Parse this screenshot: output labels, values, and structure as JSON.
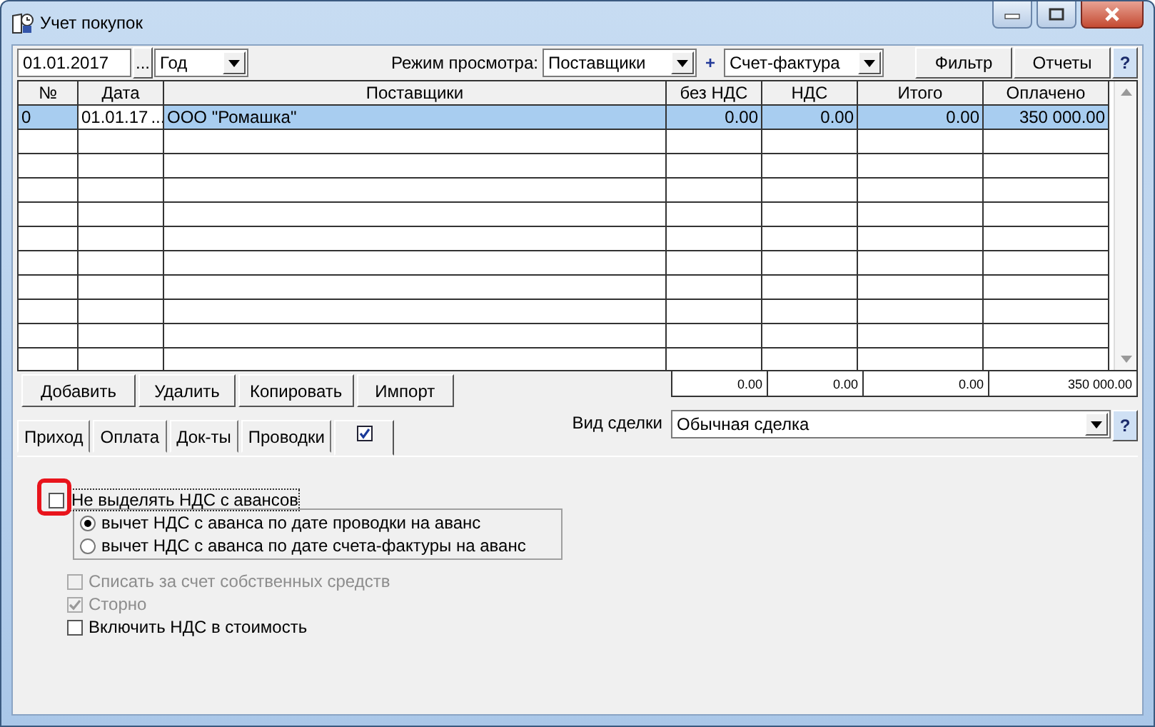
{
  "window": {
    "title": "Учет покупок"
  },
  "toolbar": {
    "date": "01.01.2017",
    "date_button": "...",
    "period": "Год",
    "view_mode_label": "Режим просмотра:",
    "view_mode": "Поставщики",
    "plus": "+",
    "document_type": "Счет-фактура",
    "buttons": [
      "Фильтр",
      "Отчеты"
    ],
    "help": "?"
  },
  "table": {
    "columns": [
      "№",
      "Дата",
      "Поставщики",
      "без НДС",
      "НДС",
      "Итого",
      "Оплачено"
    ],
    "rows": [
      {
        "selected": true,
        "cells": [
          "0",
          "01.01.17",
          "ООО \"Ромашка\"",
          "0.00",
          "0.00",
          "0.00",
          "350 000.00"
        ],
        "date_button": "..."
      }
    ],
    "totals": [
      "0.00",
      "0.00",
      "0.00",
      "350 000.00"
    ]
  },
  "actions": [
    "Добавить",
    "Удалить",
    "Копировать",
    "Импорт"
  ],
  "deal_type": {
    "label": "Вид сделки",
    "value": "Обычная сделка",
    "help": "?"
  },
  "tabs": [
    {
      "kind": "text",
      "label": "Приход",
      "selected": false
    },
    {
      "kind": "text",
      "label": "Оплата",
      "selected": false
    },
    {
      "kind": "text",
      "label": "Док-ты",
      "selected": false
    },
    {
      "kind": "text",
      "label": "Проводки",
      "selected": false
    },
    {
      "kind": "icon",
      "selected": true
    }
  ],
  "advance_group": {
    "label": "Не выделять НДС с авансов",
    "checked": false,
    "highlighted": true,
    "options": [
      {
        "label": "вычет НДС с аванса по дате проводки на аванс",
        "selected": true
      },
      {
        "label": "вычет НДС с аванса по дате счета-фактуры на аванс",
        "selected": false
      }
    ]
  },
  "checkboxes": [
    {
      "label": "Списать за счет собственных средств",
      "checked": false,
      "disabled": true
    },
    {
      "label": "Сторно",
      "checked": true,
      "disabled": true
    },
    {
      "label": "Включить НДС в стоимость",
      "checked": false,
      "disabled": false
    }
  ]
}
